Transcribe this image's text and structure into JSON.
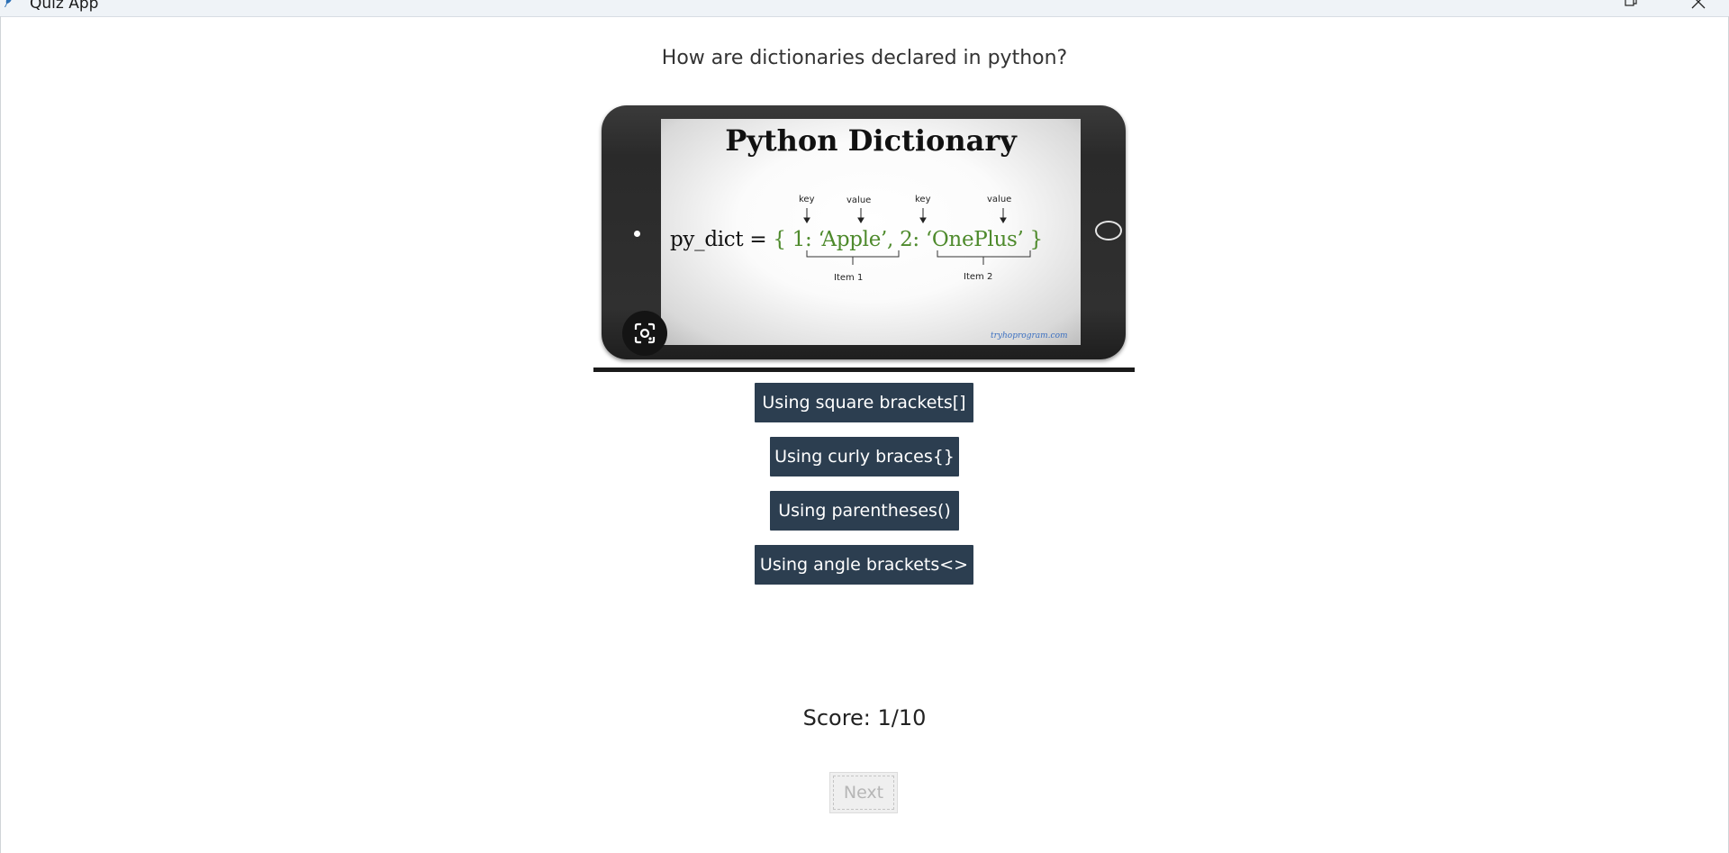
{
  "window": {
    "title": "Quiz App"
  },
  "quiz": {
    "question": "How are dictionaries declared in python?",
    "image": {
      "heading": "Python Dictionary",
      "code_prefix": "py_dict = ",
      "code_body": "{ 1: ‘Apple’, 2: ‘OnePlus’ }",
      "annotations": {
        "key1": "key",
        "value1": "value",
        "key2": "key",
        "value2": "value",
        "item1": "Item 1",
        "item2": "Item 2"
      },
      "watermark": "tryhoprogram.com",
      "code_color": "#4e8a2c"
    },
    "options": [
      "Using square brackets[]",
      "Using curly braces{}",
      "Using parentheses()",
      "Using angle brackets<>"
    ],
    "option_color": "#2c3e50",
    "score_text": "Score: 1/10",
    "next_label": "Next",
    "next_enabled": false
  }
}
